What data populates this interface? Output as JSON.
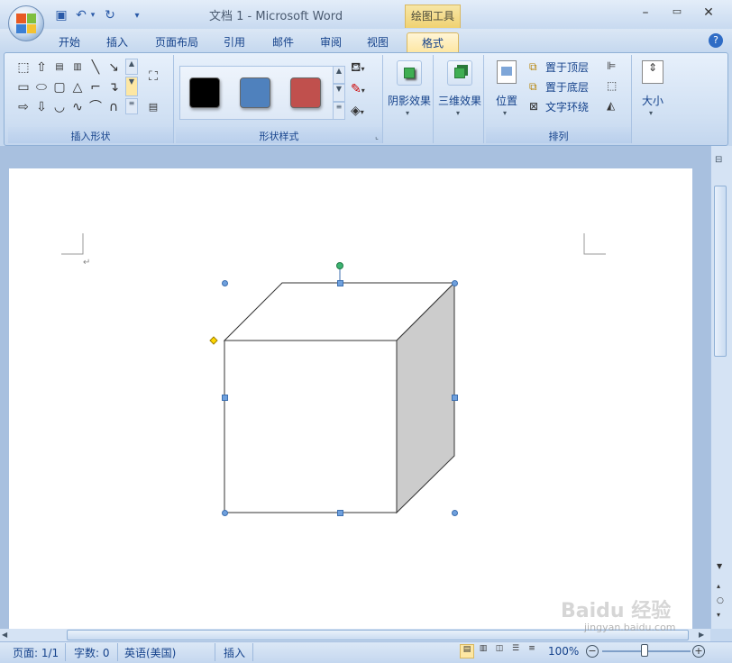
{
  "window": {
    "title": "文档 1 - Microsoft Word",
    "context_tab_group": "绘图工具",
    "controls": [
      "minimize",
      "restore",
      "close"
    ]
  },
  "qat": {
    "icons": [
      "save-icon",
      "undo-icon",
      "redo-icon",
      "customize-qat-icon"
    ]
  },
  "tabs": [
    {
      "label": "开始"
    },
    {
      "label": "插入"
    },
    {
      "label": "页面布局"
    },
    {
      "label": "引用"
    },
    {
      "label": "邮件"
    },
    {
      "label": "审阅"
    },
    {
      "label": "视图"
    },
    {
      "label": "格式",
      "active": true
    }
  ],
  "ribbon": {
    "insert_shapes": {
      "label": "插入形状"
    },
    "shape_styles": {
      "label": "形状样式",
      "swatches": [
        "#000000",
        "#4f81bd",
        "#c0504d"
      ]
    },
    "shadow": {
      "label": "阴影效果"
    },
    "three_d": {
      "label": "三维效果"
    },
    "arrange": {
      "label": "排列",
      "position": "位置",
      "bring_front": "置于顶层",
      "send_back": "置于底层",
      "text_wrap": "文字环绕"
    },
    "size": {
      "label": "大小"
    }
  },
  "status": {
    "page": "页面: 1/1",
    "words": "字数: 0",
    "language": "英语(美国)",
    "mode": "插入",
    "zoom": "100%"
  },
  "colors": {
    "accent": "#15428b",
    "handle": "#6fa0dd",
    "rotate": "#3cb371",
    "adjust": "#ffd700"
  },
  "watermark": "Baidu 经验 jingyan.baidu.com"
}
